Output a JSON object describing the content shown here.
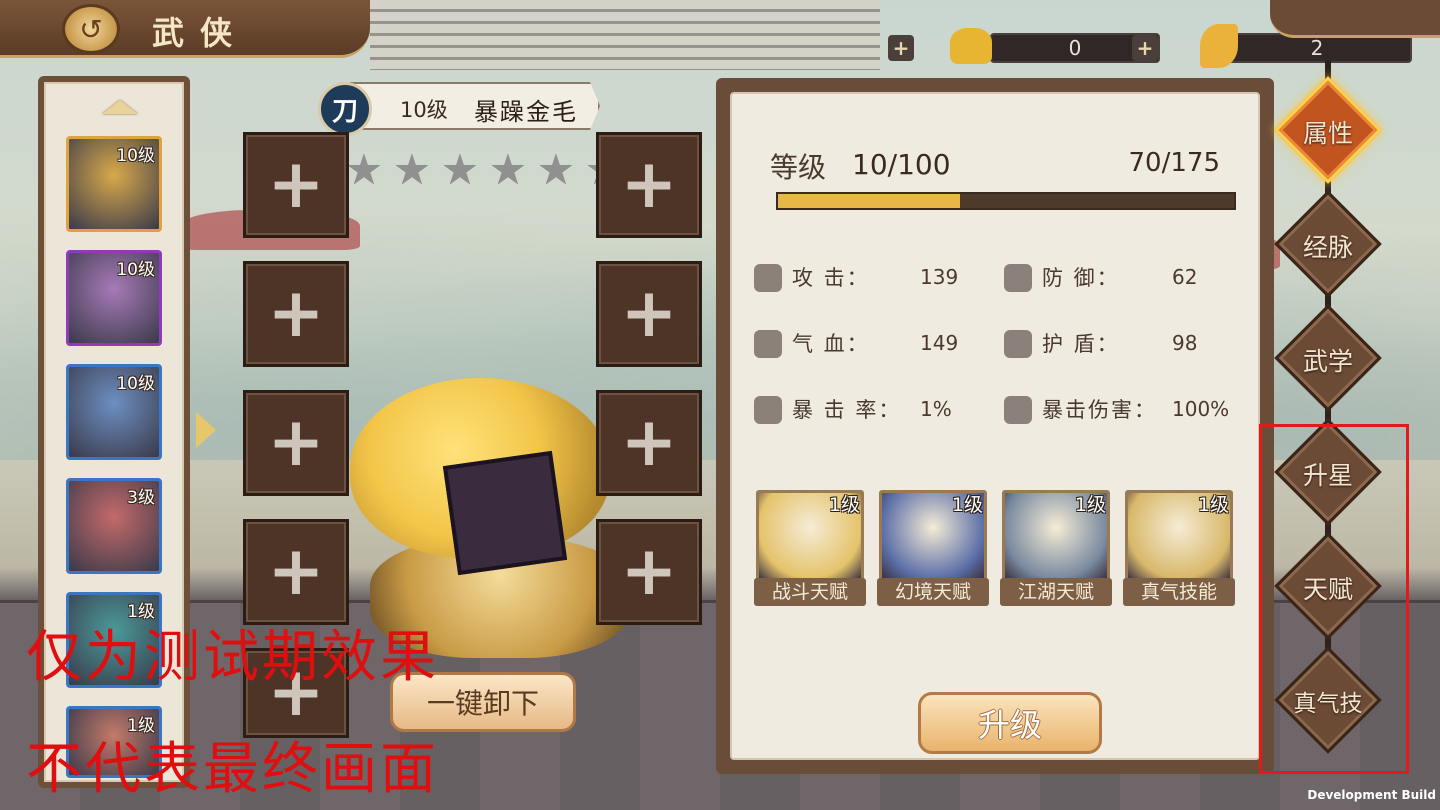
{
  "header": {
    "title": "武侠",
    "back_icon": "back-arrow-icon"
  },
  "currencies": [
    {
      "name": "gold",
      "value": "0"
    },
    {
      "name": "ingot",
      "value": "2"
    }
  ],
  "hero_list": [
    {
      "level": "10级",
      "frame_color": "#e0a23c",
      "portrait_color": "#d8a94a"
    },
    {
      "level": "10级",
      "frame_color": "#8e3bb8",
      "portrait_color": "#a77ab8"
    },
    {
      "level": "10级",
      "frame_color": "#3a76c4",
      "portrait_color": "#6d8fc2"
    },
    {
      "level": "3级",
      "frame_color": "#3a76c4",
      "portrait_color": "#c46a6a"
    },
    {
      "level": "1级",
      "frame_color": "#3a76c4",
      "portrait_color": "#4a9a9a"
    },
    {
      "level": "1级",
      "frame_color": "#3a76c4",
      "portrait_color": "#c47a6a"
    }
  ],
  "hero": {
    "weapon_badge": "刀",
    "level_text": "10级",
    "name": "暴躁金毛",
    "stars": 6,
    "stars_filled": 0
  },
  "equipment_slots": {
    "plus_symbol": "+",
    "items": [
      "hat-slot",
      "armor-slot",
      "bracer-slot",
      "belt-slot",
      "boots-slot",
      "weapon-slot",
      "accessory-slot",
      "pouch-slot",
      "staff-slot"
    ]
  },
  "unequip_button": "一键卸下",
  "watermark": {
    "line1": "仅为测试期效果",
    "line2": "不代表最终画面"
  },
  "stats": {
    "level_label": "等级",
    "level_value": "10/100",
    "exp_value": "70/175",
    "exp_progress": 0.4,
    "rows": [
      {
        "label": "攻 击：",
        "value": "139",
        "icon": "sword-icon"
      },
      {
        "label": "防 御：",
        "value": "62",
        "icon": "defense-icon"
      },
      {
        "label": "气 血：",
        "value": "149",
        "icon": "heart-icon"
      },
      {
        "label": "护 盾：",
        "value": "98",
        "icon": "shield-icon"
      },
      {
        "label": "暴 击 率：",
        "value": "1%",
        "icon": "crit-rate-icon"
      },
      {
        "label": "暴击伤害：",
        "value": "100%",
        "icon": "crit-damage-icon"
      }
    ]
  },
  "talents": [
    {
      "name": "战斗天赋",
      "level": "1级",
      "color": "#e4c36a"
    },
    {
      "name": "幻境天赋",
      "level": "1级",
      "color": "#5c6fa8"
    },
    {
      "name": "江湖天赋",
      "level": "1级",
      "color": "#7a8aa0"
    },
    {
      "name": "真气技能",
      "level": "1级",
      "color": "#d8b86a"
    }
  ],
  "upgrade_button": "升级",
  "tabs": [
    {
      "label": "属性",
      "active": true
    },
    {
      "label": "经脉",
      "active": false
    },
    {
      "label": "武学",
      "active": false
    },
    {
      "label": "升星",
      "active": false
    },
    {
      "label": "天赋",
      "active": false
    },
    {
      "label": "真气技",
      "active": false
    }
  ],
  "footer": {
    "build_label": "Development Build"
  }
}
